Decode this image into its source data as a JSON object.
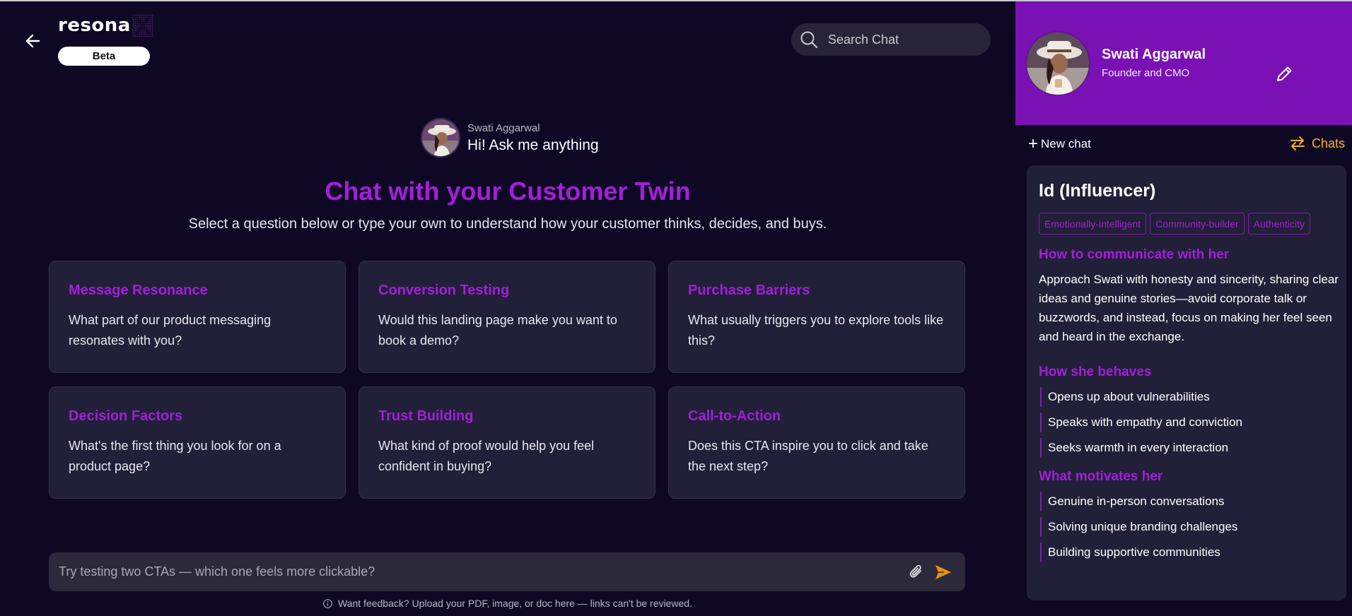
{
  "app": {
    "logo_text": "resona",
    "beta_label": "Beta"
  },
  "search": {
    "placeholder": "Search Chat"
  },
  "persona": {
    "name": "Swati Aggarwal",
    "greeting": "Hi! Ask me anything"
  },
  "main": {
    "title": "Chat with your Customer Twin",
    "subtitle": "Select a question below or type your own to understand how your customer thinks, decides, and buys.",
    "cards": [
      {
        "title": "Message Resonance",
        "text": "What part of our product messaging resonates with you?"
      },
      {
        "title": "Conversion Testing",
        "text": "Would this landing page make you want to book a demo?"
      },
      {
        "title": "Purchase Barriers",
        "text": "What usually triggers you to explore tools like this?"
      },
      {
        "title": "Decision Factors",
        "text": "What's the first thing you look for on a product page?"
      },
      {
        "title": "Trust Building",
        "text": "What kind of proof would help you feel confident in buying?"
      },
      {
        "title": "Call-to-Action",
        "text": "Does this CTA inspire you to click and take the next step?"
      }
    ]
  },
  "chat_input": {
    "placeholder": "Try testing two CTAs — which one feels more clickable?"
  },
  "footer": {
    "note": "Want feedback? Upload your PDF, image, or doc here — links can't be reviewed."
  },
  "profile": {
    "name": "Swati Aggarwal",
    "role": "Founder and CMO"
  },
  "sidebar": {
    "new_chat_label": "New chat",
    "chats_label": "Chats"
  },
  "insight": {
    "title": "Id (Influencer)",
    "tags": [
      "Emotionally-intelligent",
      "Community-builder",
      "Authenticity"
    ],
    "communicate_title": "How to communicate with her",
    "communicate_text": "Approach Swati with honesty and sincerity, sharing clear ideas and genuine stories—avoid corporate talk or buzzwords, and instead, focus on making her feel seen and heard in the exchange.",
    "behaves_title": "How she behaves",
    "behaves": [
      "Opens up about vulnerabilities",
      "Speaks with empathy and conviction",
      "Seeks warmth in every interaction"
    ],
    "motivates_title": "What motivates her",
    "motivates": [
      "Genuine in-person conversations",
      "Solving unique branding challenges",
      "Building supportive communities"
    ]
  },
  "colors": {
    "background": "#0f0824",
    "accent_purple": "#a21fd9",
    "profile_header": "#7a11b5",
    "card_bg": "#221f38",
    "chats_accent": "#f5b224",
    "send_accent": "#e8920f"
  },
  "icons": {
    "back": "arrow-left-icon",
    "search": "search-icon",
    "edit": "pencil-icon",
    "new_chat": "plus-icon",
    "chats": "swap-arrows-icon",
    "attach": "paperclip-icon",
    "send": "send-icon",
    "info": "info-icon"
  }
}
